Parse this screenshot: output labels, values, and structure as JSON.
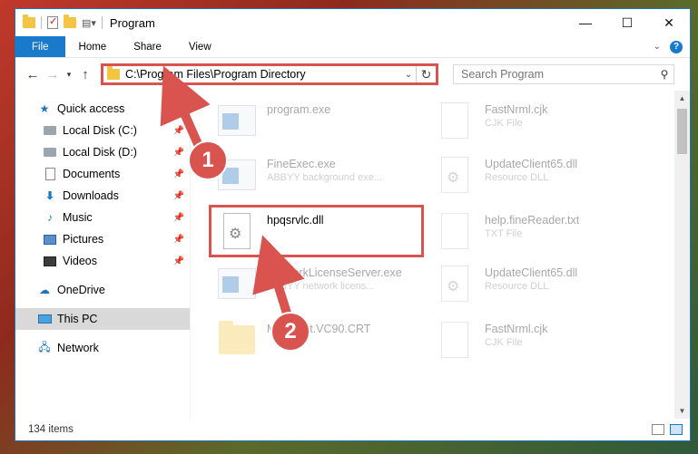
{
  "window": {
    "title": "Program",
    "controls": {
      "minimize": "—",
      "maximize": "☐",
      "close": "✕"
    }
  },
  "ribbon": {
    "tabs": [
      "File",
      "Home",
      "Share",
      "View"
    ]
  },
  "address": {
    "path": "C:\\Program Files\\Program Directory",
    "search_placeholder": "Search Program"
  },
  "nav": {
    "items": [
      {
        "label": "Quick access",
        "icon": "star-icon"
      },
      {
        "label": "Local Disk (C:)",
        "icon": "disk-icon",
        "pinned": true
      },
      {
        "label": "Local Disk (D:)",
        "icon": "disk-icon",
        "pinned": true
      },
      {
        "label": "Documents",
        "icon": "documents-icon",
        "pinned": true
      },
      {
        "label": "Downloads",
        "icon": "downloads-icon",
        "pinned": true
      },
      {
        "label": "Music",
        "icon": "music-icon",
        "pinned": true
      },
      {
        "label": "Pictures",
        "icon": "pictures-icon",
        "pinned": true
      },
      {
        "label": "Videos",
        "icon": "videos-icon",
        "pinned": true
      },
      {
        "label": "OneDrive",
        "icon": "onedrive-icon"
      },
      {
        "label": "This PC",
        "icon": "pc-icon",
        "selected": true
      },
      {
        "label": "Network",
        "icon": "network-icon"
      }
    ]
  },
  "files": {
    "left": [
      {
        "name": "program.exe",
        "type": "",
        "kind": "exe"
      },
      {
        "name": "FineExec.exe",
        "type": "ABBYY background exe...",
        "kind": "exe"
      },
      {
        "name": "hpqsrvlc.dll",
        "type": "",
        "kind": "dll",
        "highlighted": true
      },
      {
        "name": "NetworkLicenseServer.exe",
        "type": "ABBYY network licens...",
        "kind": "exe"
      },
      {
        "name": "Microsoft.VC90.CRT",
        "type": "",
        "kind": "folder"
      }
    ],
    "right": [
      {
        "name": "FastNrml.cjk",
        "type": "CJK File",
        "kind": "doc"
      },
      {
        "name": "UpdateClient65.dll",
        "type": "Resource DLL",
        "kind": "dll"
      },
      {
        "name": "help.fineReader.txt",
        "type": "TXT File",
        "kind": "doc"
      },
      {
        "name": "UpdateClient65.dll",
        "type": "Resource DLL",
        "kind": "dll"
      },
      {
        "name": "FastNrml.cjk",
        "type": "CJK File",
        "kind": "doc"
      }
    ]
  },
  "status": {
    "count": "134 items"
  },
  "annotations": {
    "step1": "1",
    "step2": "2"
  },
  "colors": {
    "accent": "#1979ca",
    "highlight": "#d9534f"
  }
}
